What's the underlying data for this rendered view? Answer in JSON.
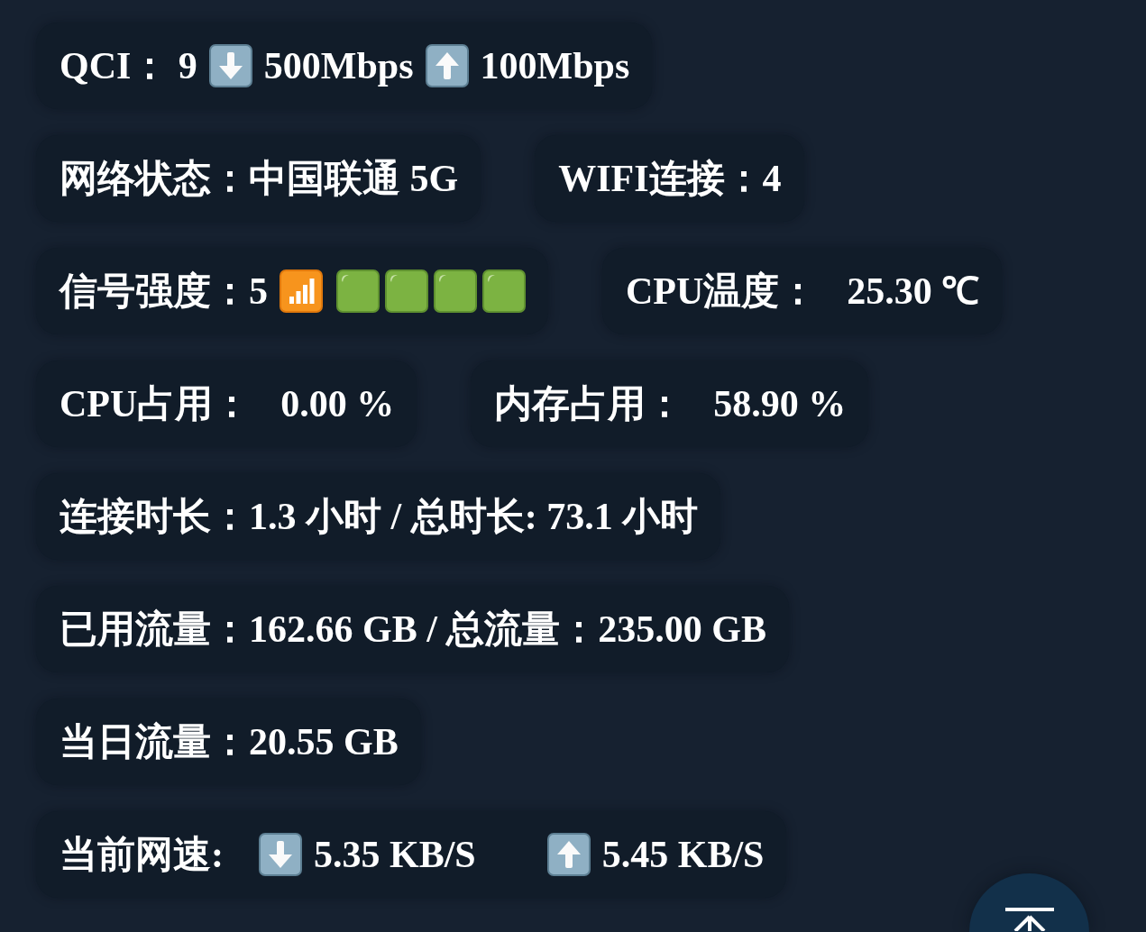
{
  "status_rows": [
    [
      {
        "kind": "qci",
        "text": "QCI： 9",
        "downlink": "500Mbps",
        "uplink": "100Mbps"
      }
    ],
    [
      {
        "kind": "text",
        "text": "网络状态：中国联通 5G"
      },
      {
        "kind": "text",
        "text": "WIFI连接：4"
      }
    ],
    [
      {
        "kind": "signal",
        "text": "信号强度：5",
        "blocks": [
          {
            "on": true
          },
          {
            "on": true
          },
          {
            "on": true
          },
          {
            "on": true
          }
        ]
      },
      {
        "kind": "pair",
        "label": "CPU温度：",
        "value": "25.30 ℃"
      }
    ],
    [
      {
        "kind": "pair",
        "label": "CPU占用：",
        "value": "0.00 %"
      },
      {
        "kind": "pair",
        "label": "内存占用：",
        "value": "58.90 %"
      }
    ],
    [
      {
        "kind": "text",
        "text": "连接时长：1.3 小时 / 总时长: 73.1 小时"
      }
    ],
    [
      {
        "kind": "text",
        "text": "已用流量：162.66 GB / 总流量：235.00 GB"
      }
    ],
    [
      {
        "kind": "text",
        "text": "当日流量：20.55 GB"
      }
    ],
    [
      {
        "kind": "speed",
        "label": "当前网速:",
        "download": "5.35 KB/S",
        "upload": "5.45 KB/S"
      }
    ]
  ]
}
